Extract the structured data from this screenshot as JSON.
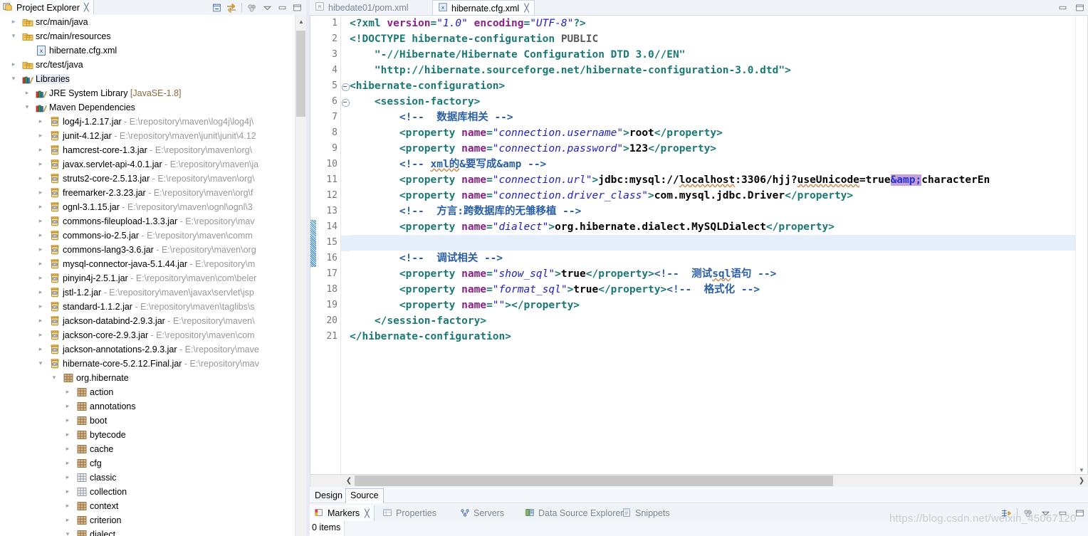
{
  "explorer": {
    "tab_label": "Project Explorer",
    "close_glyph": "╳",
    "tools": [
      "collapse-all-icon",
      "link-with-editor-icon",
      "view-menu-icon",
      "minimize-icon",
      "maximize-icon"
    ],
    "tree": [
      {
        "indent": 1,
        "arrow": "›",
        "icon": "package-folder",
        "label": "src/main/java",
        "detail": ""
      },
      {
        "indent": 1,
        "arrow": "⌄",
        "icon": "package-folder",
        "label": "src/main/resources",
        "detail": ""
      },
      {
        "indent": 2,
        "arrow": "",
        "icon": "xml-file",
        "label": "hibernate.cfg.xml",
        "detail": ""
      },
      {
        "indent": 1,
        "arrow": "›",
        "icon": "package-folder",
        "label": "src/test/java",
        "detail": ""
      },
      {
        "indent": 1,
        "arrow": "⌄",
        "icon": "library",
        "label": "Libraries",
        "detail": "",
        "selected": true
      },
      {
        "indent": 2,
        "arrow": "›",
        "icon": "library",
        "label": "JRE System Library",
        "detail": " [JavaSE-1.8]",
        "detailKind": "jre"
      },
      {
        "indent": 2,
        "arrow": "⌄",
        "icon": "library",
        "label": "Maven Dependencies",
        "detail": ""
      },
      {
        "indent": 3,
        "arrow": "›",
        "icon": "jar",
        "label": "log4j-1.2.17.jar",
        "detail": " - E:\\repository\\maven\\log4j\\log4j\\"
      },
      {
        "indent": 3,
        "arrow": "›",
        "icon": "jar",
        "label": "junit-4.12.jar",
        "detail": " - E:\\repository\\maven\\junit\\junit\\4.12"
      },
      {
        "indent": 3,
        "arrow": "›",
        "icon": "jar",
        "label": "hamcrest-core-1.3.jar",
        "detail": " - E:\\repository\\maven\\org\\"
      },
      {
        "indent": 3,
        "arrow": "›",
        "icon": "jar",
        "label": "javax.servlet-api-4.0.1.jar",
        "detail": " - E:\\repository\\maven\\ja"
      },
      {
        "indent": 3,
        "arrow": "›",
        "icon": "jar",
        "label": "struts2-core-2.5.13.jar",
        "detail": " - E:\\repository\\maven\\org\\"
      },
      {
        "indent": 3,
        "arrow": "›",
        "icon": "jar",
        "label": "freemarker-2.3.23.jar",
        "detail": " - E:\\repository\\maven\\org\\f"
      },
      {
        "indent": 3,
        "arrow": "›",
        "icon": "jar",
        "label": "ognl-3.1.15.jar",
        "detail": " - E:\\repository\\maven\\ognl\\ognl\\3"
      },
      {
        "indent": 3,
        "arrow": "›",
        "icon": "jar",
        "label": "commons-fileupload-1.3.3.jar",
        "detail": " - E:\\repository\\mav"
      },
      {
        "indent": 3,
        "arrow": "›",
        "icon": "jar",
        "label": "commons-io-2.5.jar",
        "detail": " - E:\\repository\\maven\\comm"
      },
      {
        "indent": 3,
        "arrow": "›",
        "icon": "jar",
        "label": "commons-lang3-3.6.jar",
        "detail": " - E:\\repository\\maven\\org"
      },
      {
        "indent": 3,
        "arrow": "›",
        "icon": "jar",
        "label": "mysql-connector-java-5.1.44.jar",
        "detail": " - E:\\repository\\m"
      },
      {
        "indent": 3,
        "arrow": "›",
        "icon": "jar",
        "label": "pinyin4j-2.5.1.jar",
        "detail": " - E:\\repository\\maven\\com\\beler"
      },
      {
        "indent": 3,
        "arrow": "›",
        "icon": "jar",
        "label": "jstl-1.2.jar",
        "detail": " - E:\\repository\\maven\\javax\\servlet\\jsp"
      },
      {
        "indent": 3,
        "arrow": "›",
        "icon": "jar",
        "label": "standard-1.1.2.jar",
        "detail": " - E:\\repository\\maven\\taglibs\\s"
      },
      {
        "indent": 3,
        "arrow": "›",
        "icon": "jar",
        "label": "jackson-databind-2.9.3.jar",
        "detail": " - E:\\repository\\maven\\"
      },
      {
        "indent": 3,
        "arrow": "›",
        "icon": "jar",
        "label": "jackson-core-2.9.3.jar",
        "detail": " - E:\\repository\\maven\\com"
      },
      {
        "indent": 3,
        "arrow": "›",
        "icon": "jar",
        "label": "jackson-annotations-2.9.3.jar",
        "detail": " - E:\\repository\\mave"
      },
      {
        "indent": 3,
        "arrow": "⌄",
        "icon": "jar",
        "label": "hibernate-core-5.2.12.Final.jar",
        "detail": " - E:\\repository\\mav"
      },
      {
        "indent": 4,
        "arrow": "⌄",
        "icon": "package",
        "label": "org.hibernate",
        "detail": ""
      },
      {
        "indent": 5,
        "arrow": "›",
        "icon": "package",
        "label": "action",
        "detail": ""
      },
      {
        "indent": 5,
        "arrow": "›",
        "icon": "package",
        "label": "annotations",
        "detail": ""
      },
      {
        "indent": 5,
        "arrow": "›",
        "icon": "package",
        "label": "boot",
        "detail": ""
      },
      {
        "indent": 5,
        "arrow": "›",
        "icon": "package",
        "label": "bytecode",
        "detail": ""
      },
      {
        "indent": 5,
        "arrow": "›",
        "icon": "package",
        "label": "cache",
        "detail": ""
      },
      {
        "indent": 5,
        "arrow": "›",
        "icon": "package",
        "label": "cfg",
        "detail": ""
      },
      {
        "indent": 5,
        "arrow": "›",
        "icon": "package-empty",
        "label": "classic",
        "detail": ""
      },
      {
        "indent": 5,
        "arrow": "›",
        "icon": "package-empty",
        "label": "collection",
        "detail": ""
      },
      {
        "indent": 5,
        "arrow": "›",
        "icon": "package",
        "label": "context",
        "detail": ""
      },
      {
        "indent": 5,
        "arrow": "›",
        "icon": "package",
        "label": "criterion",
        "detail": ""
      },
      {
        "indent": 5,
        "arrow": "⌄",
        "icon": "package",
        "label": "dialect",
        "detail": ""
      }
    ]
  },
  "editor": {
    "tabs": [
      {
        "label": "hibedate01/pom.xml",
        "icon": "maven-file-icon",
        "active": false
      },
      {
        "label": "hibernate.cfg.xml",
        "icon": "xml-file-icon",
        "active": true,
        "close_glyph": "╳"
      }
    ],
    "tools": [
      "minimize-icon",
      "maximize-icon"
    ],
    "line_count": 21,
    "highlight_line": 15,
    "change_bar_lines": [
      14,
      15,
      16
    ],
    "fold_lines": [
      5,
      6
    ],
    "lines": [
      {
        "n": 1,
        "tokens": [
          {
            "t": "tg",
            "v": "<?xml "
          },
          {
            "t": "at",
            "v": "version"
          },
          {
            "t": "tg",
            "v": "="
          },
          {
            "t": "av",
            "v": "\"1.0\""
          },
          {
            "t": "tg",
            "v": " "
          },
          {
            "t": "at",
            "v": "encoding"
          },
          {
            "t": "tg",
            "v": "="
          },
          {
            "t": "av",
            "v": "\"UTF-8\""
          },
          {
            "t": "tg",
            "v": "?>"
          }
        ]
      },
      {
        "n": 2,
        "tokens": [
          {
            "t": "tg",
            "v": "<!DOCTYPE hibernate-configuration "
          },
          {
            "t": "kw",
            "v": "PUBLIC"
          }
        ]
      },
      {
        "n": 3,
        "tokens": [
          {
            "t": "tg",
            "v": "    \"-//Hibernate/Hibernate Configuration DTD 3.0//EN\""
          }
        ]
      },
      {
        "n": 4,
        "tokens": [
          {
            "t": "tg",
            "v": "    \"http://hibernate.sourceforge.net/hibernate-configuration-3.0.dtd\">"
          }
        ]
      },
      {
        "n": 5,
        "tokens": [
          {
            "t": "tg",
            "v": "<hibernate-configuration>"
          }
        ]
      },
      {
        "n": 6,
        "tokens": [
          {
            "t": "tg",
            "v": "    <session-factory>"
          }
        ]
      },
      {
        "n": 7,
        "tokens": [
          {
            "t": "cm",
            "v": "        <!--  数据库相关 -->"
          }
        ]
      },
      {
        "n": 8,
        "tokens": [
          {
            "t": "tg",
            "v": "        <property "
          },
          {
            "t": "at",
            "v": "name"
          },
          {
            "t": "tg",
            "v": "="
          },
          {
            "t": "av",
            "v": "\"connection.username\""
          },
          {
            "t": "tg",
            "v": ">"
          },
          {
            "t": "tx",
            "v": "root"
          },
          {
            "t": "tg",
            "v": "</property>"
          }
        ]
      },
      {
        "n": 9,
        "tokens": [
          {
            "t": "tg",
            "v": "        <property "
          },
          {
            "t": "at",
            "v": "name"
          },
          {
            "t": "tg",
            "v": "="
          },
          {
            "t": "av",
            "v": "\"connection.password\""
          },
          {
            "t": "tg",
            "v": ">"
          },
          {
            "t": "tx",
            "v": "123"
          },
          {
            "t": "tg",
            "v": "</property>"
          }
        ]
      },
      {
        "n": 10,
        "tokens": [
          {
            "t": "cm",
            "v": "        <!-- "
          },
          {
            "t": "cm sq",
            "v": "xml的"
          },
          {
            "t": "cm",
            "v": "&要写成"
          },
          {
            "t": "cm",
            "v": "&amp"
          },
          {
            "t": "cm",
            "v": " -->"
          }
        ]
      },
      {
        "n": 11,
        "tokens": [
          {
            "t": "tg",
            "v": "        <property "
          },
          {
            "t": "at",
            "v": "name"
          },
          {
            "t": "tg",
            "v": "="
          },
          {
            "t": "av",
            "v": "\"connection.url\""
          },
          {
            "t": "tg",
            "v": ">"
          },
          {
            "t": "tx",
            "v": "jdbc:mysql://"
          },
          {
            "t": "tx sq",
            "v": "localhost"
          },
          {
            "t": "tx",
            "v": ":3306/hjj?"
          },
          {
            "t": "tx sq",
            "v": "useUnicode"
          },
          {
            "t": "tx",
            "v": "=true"
          },
          {
            "t": "ent",
            "v": "&amp;"
          },
          {
            "t": "tx",
            "v": "characterEn"
          }
        ]
      },
      {
        "n": 12,
        "tokens": [
          {
            "t": "tg",
            "v": "        <property "
          },
          {
            "t": "at",
            "v": "name"
          },
          {
            "t": "tg",
            "v": "="
          },
          {
            "t": "av",
            "v": "\"connection.driver_class\""
          },
          {
            "t": "tg",
            "v": ">"
          },
          {
            "t": "tx",
            "v": "com.mysql.jdbc.Driver"
          },
          {
            "t": "tg",
            "v": "</property>"
          }
        ]
      },
      {
        "n": 13,
        "tokens": [
          {
            "t": "cm",
            "v": "        <!--  方言:跨数据库的无雏移植 -->"
          }
        ]
      },
      {
        "n": 14,
        "tokens": [
          {
            "t": "tg",
            "v": "        <property "
          },
          {
            "t": "at",
            "v": "name"
          },
          {
            "t": "tg",
            "v": "="
          },
          {
            "t": "av",
            "v": "\"dialect\""
          },
          {
            "t": "tg",
            "v": ">"
          },
          {
            "t": "tx",
            "v": "org.hibernate.dialect.MySQLDialect"
          },
          {
            "t": "tg",
            "v": "</property>"
          }
        ]
      },
      {
        "n": 15,
        "tokens": []
      },
      {
        "n": 16,
        "tokens": [
          {
            "t": "cm",
            "v": "        <!--  调试相关 -->"
          }
        ]
      },
      {
        "n": 17,
        "tokens": [
          {
            "t": "tg",
            "v": "        <property "
          },
          {
            "t": "at",
            "v": "name"
          },
          {
            "t": "tg",
            "v": "="
          },
          {
            "t": "av",
            "v": "\"show_sql\""
          },
          {
            "t": "tg",
            "v": ">"
          },
          {
            "t": "tx",
            "v": "true"
          },
          {
            "t": "tg",
            "v": "</property>"
          },
          {
            "t": "cm",
            "v": "<!--  测试"
          },
          {
            "t": "cm sq",
            "v": "sql"
          },
          {
            "t": "cm",
            "v": "语句 -->"
          }
        ]
      },
      {
        "n": 18,
        "tokens": [
          {
            "t": "tg",
            "v": "        <property "
          },
          {
            "t": "at",
            "v": "name"
          },
          {
            "t": "tg",
            "v": "="
          },
          {
            "t": "av",
            "v": "\"format_sql\""
          },
          {
            "t": "tg",
            "v": ">"
          },
          {
            "t": "tx",
            "v": "true"
          },
          {
            "t": "tg",
            "v": "</property>"
          },
          {
            "t": "cm",
            "v": "<!--  格式化 -->"
          }
        ]
      },
      {
        "n": 19,
        "tokens": [
          {
            "t": "tg",
            "v": "        <property "
          },
          {
            "t": "at",
            "v": "name"
          },
          {
            "t": "tg",
            "v": "="
          },
          {
            "t": "av",
            "v": "\"\""
          },
          {
            "t": "tg",
            "v": "></property>"
          }
        ]
      },
      {
        "n": 20,
        "tokens": [
          {
            "t": "tg",
            "v": "    </session-factory>"
          }
        ]
      },
      {
        "n": 21,
        "tokens": [
          {
            "t": "tg",
            "v": "</hibernate-configuration>"
          }
        ]
      }
    ]
  },
  "design_source": {
    "design_label": "Design",
    "source_label": "Source",
    "active": "Source"
  },
  "bottom_panel": {
    "tabs": [
      {
        "label": "Markers",
        "icon": "markers-icon",
        "active": true,
        "close_glyph": "╳"
      },
      {
        "label": "Properties",
        "icon": "properties-icon",
        "active": false
      },
      {
        "label": "Servers",
        "icon": "servers-icon",
        "active": false
      },
      {
        "label": "Data Source Explorer",
        "icon": "datasource-icon",
        "active": false
      },
      {
        "label": "Snippets",
        "icon": "snippets-icon",
        "active": false
      }
    ],
    "status": "0 items",
    "tools": [
      "filters-icon",
      "view-menu-icon",
      "minimize-icon",
      "maximize-icon"
    ]
  },
  "watermark": "https://blog.csdn.net/weixin_45067120",
  "colors": {
    "tag": "#1a7a73",
    "attr_name": "#8b1f8b",
    "attr_value": "#2020cc",
    "comment": "#2a5fa5",
    "entity_bg": "#c8a0d8",
    "current_line": "#e5eefb",
    "chrome": "#f0f3f8"
  }
}
